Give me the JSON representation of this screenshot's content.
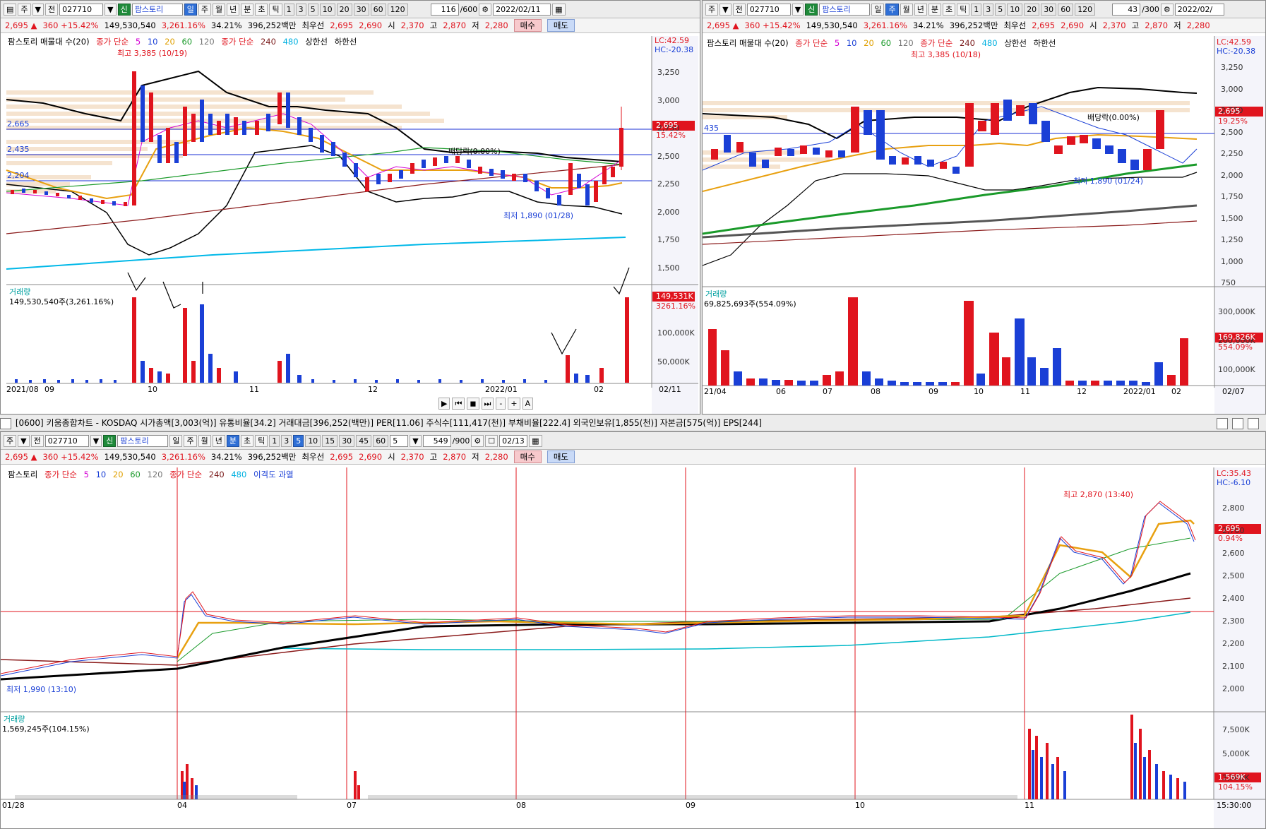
{
  "common": {
    "menu_glyph": "▤",
    "tb_ju": "주",
    "tb_jeon": "전",
    "code": "027710",
    "dropdown_arrow": "▼",
    "sin": "신",
    "palstory": "팜스토리",
    "periods": [
      "일",
      "주",
      "월",
      "년",
      "분",
      "초",
      "틱"
    ],
    "nums_top": [
      "1",
      "3",
      "5",
      "10",
      "20",
      "30",
      "60",
      "120"
    ],
    "price": "2,695",
    "up_arrow": "▲",
    "change": "360",
    "change_pct": "+15.42%",
    "volume": "149,530,540",
    "vol_ratio": "3,261.16%",
    "turnover_pct": "34.21%",
    "amount": "396,252백만",
    "best_ask_label": "최우선",
    "best_ask": "2,695",
    "best_bid": "2,690",
    "open_label": "시",
    "open": "2,370",
    "high_label": "고",
    "high": "2,870",
    "low_label": "저",
    "low": "2,280",
    "buy": "매수",
    "sell": "매도",
    "lc": "LC:42.59",
    "hc": "HC:-20.38"
  },
  "left": {
    "count": "116",
    "total": "/600",
    "date": "2022/02/11",
    "legend": {
      "name": "팜스토리 매물대 수(20)",
      "ma_label": "종가 단순",
      "ma": [
        "5",
        "10",
        "20",
        "60",
        "120"
      ],
      "ma2_label": "종가 단순",
      "ma2": [
        "240",
        "480"
      ],
      "bands": "상한선",
      "bands2": "하한선"
    },
    "price_axis": [
      "3,250",
      "3,000",
      "2,750",
      "2,500",
      "2,250",
      "2,000",
      "1,750",
      "1,500"
    ],
    "hlines": [
      "2,665",
      "2,435",
      "2,204"
    ],
    "tag_price": "2,695",
    "tag_pct": "15.42%",
    "high_note": "최고 3,385 (10/19)",
    "low_note": "최저 1,890 (01/28)",
    "dividend": "배당락(0.00%)",
    "vol_title": "거래량",
    "vol_info": "149,530,540주(3,261.16%)",
    "vol_axis": [
      "100,000K",
      "50,000K"
    ],
    "vol_tag1": "149,531K",
    "vol_tag2": "3261.16%",
    "x_labels": [
      "2021/08",
      "09",
      "10",
      "11",
      "12",
      "2022/01",
      "02"
    ],
    "x_end": "02/11",
    "nav": [
      "▶",
      "⏮",
      "◼",
      "⏭",
      "-",
      "+",
      "A"
    ]
  },
  "right": {
    "count": "43",
    "total": "/300",
    "date": "2022/02/",
    "legend": {
      "name": "팜스토리 매물대 수(20)",
      "ma_label": "종가 단순",
      "ma": [
        "5",
        "10",
        "20",
        "60",
        "120"
      ],
      "ma2_label": "종가 단순",
      "ma2": [
        "240",
        "480"
      ],
      "bands": "상한선",
      "bands2": "하한선"
    },
    "price_axis": [
      "3,250",
      "3,000",
      "2,750",
      "2,500",
      "2,250",
      "2,000",
      "1,750",
      "1,500",
      "1,250",
      "1,000",
      "750"
    ],
    "tag_price": "2,695",
    "tag_pct": "19.25%",
    "hline": "435",
    "high_note": "최고 3,385 (10/18)",
    "low_note": "최저 1,890 (01/24)",
    "dividend": "배당락(0.00%)",
    "vol_title": "거래량",
    "vol_info": "69,825,693주(554.09%)",
    "vol_axis": [
      "300,000K",
      "200,000K",
      "100,000K"
    ],
    "vol_tag1": "169,826K",
    "vol_tag2": "554.09%",
    "x_labels": [
      "21/04",
      "06",
      "07",
      "08",
      "09",
      "10",
      "11",
      "12",
      "2022/01",
      "02"
    ],
    "x_end": "02/07"
  },
  "bottom": {
    "window_title": "[0600] 키움종합차트 - KOSDAQ 시가총액[3,003(억)] 유통비율[34.2] 거래대금[396,252(백만)] PER[11.06] 주식수[111,417(천)] 부채비율[222.4] 외국인보유[1,855(천)] 자본금[575(억)] EPS[244]",
    "nums": [
      "1",
      "3",
      "5",
      "10",
      "15",
      "30",
      "45",
      "60"
    ],
    "interval": "5",
    "count": "549",
    "total": "/900",
    "date": "02/13",
    "lc": "LC:35.43",
    "hc": "HC:-6.10",
    "legend": {
      "name": "팜스토리",
      "ma_label": "종가 단순",
      "ma": [
        "5",
        "10",
        "20",
        "60",
        "120"
      ],
      "ma2_label": "종가 단순",
      "ma2": [
        "240",
        "480"
      ],
      "extra": "이격도 과열"
    },
    "price_axis": [
      "2,800",
      "2,700",
      "2,600",
      "2,500",
      "2,400",
      "2,300",
      "2,200",
      "2,100",
      "2,000"
    ],
    "tag_price": "2,695",
    "tag_pct": "0.94%",
    "high_note": "최고 2,870 (13:40)",
    "low_note": "최저 1,990 (13:10)",
    "vol_title": "거래량",
    "vol_info": "1,569,245주(104.15%)",
    "vol_axis": [
      "7,500K",
      "5,000K",
      "2,500K"
    ],
    "vol_tag1": "1,569K",
    "vol_tag2": "104.15%",
    "x_labels": [
      "01/28",
      "04",
      "07",
      "08",
      "09",
      "10",
      "11"
    ],
    "x_end": "15:30:00"
  }
}
